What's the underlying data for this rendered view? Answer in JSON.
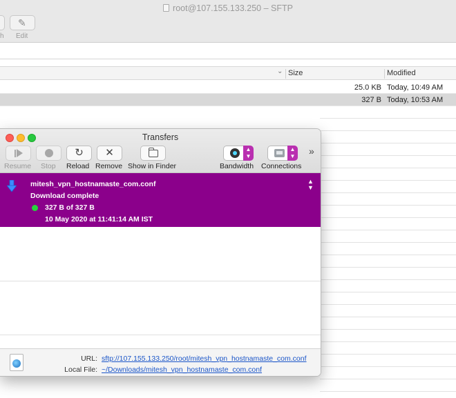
{
  "sftp_window": {
    "title": "root@107.155.133.250 – SFTP",
    "toolbar": {
      "partial_label": "h",
      "edit_label": "Edit"
    },
    "columns": {
      "size": "Size",
      "modified": "Modified"
    },
    "rows": [
      {
        "size": "25.0 KB",
        "modified": "Today, 10:49 AM",
        "selected": false
      },
      {
        "size": "327 B",
        "modified": "Today, 10:53 AM",
        "selected": true
      }
    ]
  },
  "transfers_window": {
    "title": "Transfers",
    "toolbar": {
      "resume_label": "Resume",
      "stop_label": "Stop",
      "reload_label": "Reload",
      "remove_label": "Remove",
      "show_in_finder_label": "Show in Finder",
      "bandwidth_label": "Bandwidth",
      "connections_label": "Connections",
      "overflow_glyph": "»"
    },
    "transfer": {
      "filename": "mitesh_vpn_hostnamaste_com.conf",
      "status": "Download complete",
      "progress": "327 B of 327 B",
      "date": "10 May 2020 at 11:41:14 AM IST",
      "highlight_color": "#8b008b"
    },
    "footer": {
      "url_label": "URL:",
      "url_value": "sftp://107.155.133.250/root/mitesh_vpn_hostnamaste_com.conf",
      "local_label": "Local File:",
      "local_value": "~/Downloads/mitesh_vpn_hostnamaste_com.conf"
    }
  }
}
